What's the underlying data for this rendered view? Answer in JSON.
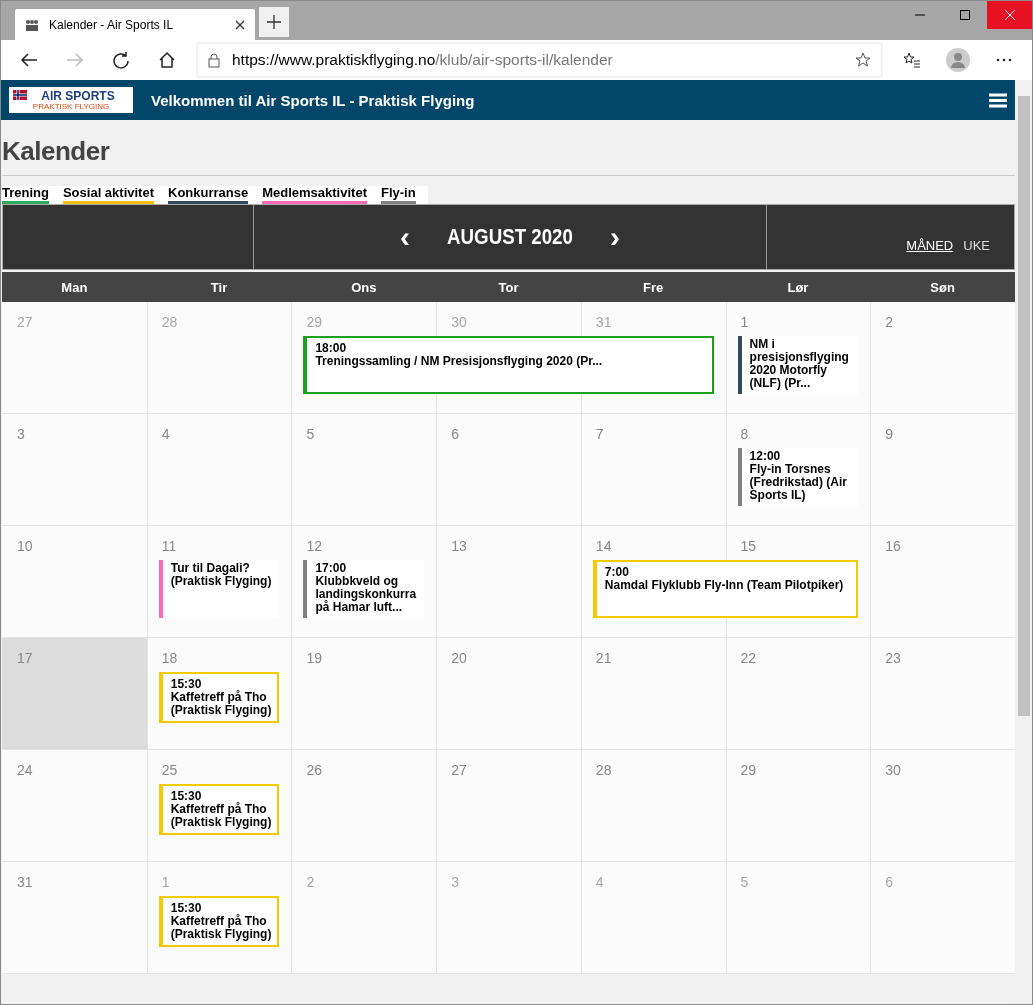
{
  "browser": {
    "tab_title": "Kalender - Air Sports IL",
    "url_host": "https://www.praktiskflyging.no",
    "url_path": "/klub/air-sports-il/kalender"
  },
  "site": {
    "logo_title": "AIR SPORTS",
    "logo_subtitle": "PRAKTISK FLYGING",
    "title": "Velkommen til Air Sports IL - Praktisk Flyging"
  },
  "page_title": "Kalender",
  "legend": [
    {
      "label": "Trening",
      "color": "#2eaa5c"
    },
    {
      "label": "Sosial aktivitet",
      "color": "#f2c10f"
    },
    {
      "label": "Konkurranse",
      "color": "#34495e"
    },
    {
      "label": "Medlemsaktivitet",
      "color": "#ff69b4"
    },
    {
      "label": "Fly-in",
      "color": "#808080"
    }
  ],
  "nav": {
    "prev": "‹",
    "month": "AUGUST 2020",
    "next": "›",
    "views": [
      {
        "label": "MÅNED",
        "selected": true
      },
      {
        "label": "UKE",
        "selected": false
      }
    ]
  },
  "weekdays": [
    "Man",
    "Tir",
    "Ons",
    "Tor",
    "Fre",
    "Lør",
    "Søn"
  ],
  "weeks": [
    {
      "days": [
        {
          "label": "27",
          "other_month": true,
          "today": false
        },
        {
          "label": "28",
          "other_month": true,
          "today": false
        },
        {
          "label": "29",
          "other_month": true,
          "today": false,
          "events": [
            {
              "kind": "boxed",
              "color": "#1aa31a",
              "time": "18:00",
              "title": "Treningssamling / NM Presisjonsflyging 2020 (Pr..."
            }
          ]
        },
        {
          "label": "30",
          "other_month": true,
          "today": false
        },
        {
          "label": "31",
          "other_month": true,
          "today": false
        },
        {
          "label": "1",
          "other_month": false,
          "today": false,
          "events": [
            {
              "kind": "bar",
              "color": "#34495e",
              "title": "NM i presisjonsflyging 2020 Motorfly (NLF) (Pr..."
            }
          ]
        },
        {
          "label": "2",
          "other_month": false,
          "today": false
        }
      ]
    },
    {
      "days": [
        {
          "label": "3",
          "other_month": false,
          "today": false
        },
        {
          "label": "4",
          "other_month": false,
          "today": false
        },
        {
          "label": "5",
          "other_month": false,
          "today": false
        },
        {
          "label": "6",
          "other_month": false,
          "today": false
        },
        {
          "label": "7",
          "other_month": false,
          "today": false
        },
        {
          "label": "8",
          "other_month": false,
          "today": false,
          "events": [
            {
              "kind": "bar",
              "color": "#808080",
              "time": "12:00",
              "title": "Fly-in Torsnes (Fredrikstad) (Air Sports IL)"
            }
          ]
        },
        {
          "label": "9",
          "other_month": false,
          "today": false
        }
      ]
    },
    {
      "days": [
        {
          "label": "10",
          "other_month": false,
          "today": false
        },
        {
          "label": "11",
          "other_month": false,
          "today": false,
          "events": [
            {
              "kind": "bar",
              "color": "#ff69b4",
              "title": "Tur til Dagali? (Praktisk Flyging)"
            }
          ]
        },
        {
          "label": "12",
          "other_month": false,
          "today": false,
          "events": [
            {
              "kind": "bar",
              "color": "#808080",
              "time": "17:00",
              "title": "Klubbkveld og landingskonkurra på Hamar luft..."
            }
          ]
        },
        {
          "label": "13",
          "other_month": false,
          "today": false
        },
        {
          "label": "14",
          "other_month": false,
          "today": false,
          "events": [
            {
              "kind": "boxed",
              "color": "#f2cc00",
              "time": "7:00",
              "title": "Namdal Flyklubb Fly-Inn (Team Pilotpiker)"
            }
          ]
        },
        {
          "label": "15",
          "other_month": false,
          "today": false
        },
        {
          "label": "16",
          "other_month": false,
          "today": false
        }
      ]
    },
    {
      "days": [
        {
          "label": "17",
          "other_month": false,
          "today": true
        },
        {
          "label": "18",
          "other_month": false,
          "today": false,
          "events": [
            {
              "kind": "boxed",
              "color": "#f2cc00",
              "time": "15:30",
              "title": "Kaffetreff på Tho (Praktisk Flyging)"
            }
          ]
        },
        {
          "label": "19",
          "other_month": false,
          "today": false
        },
        {
          "label": "20",
          "other_month": false,
          "today": false
        },
        {
          "label": "21",
          "other_month": false,
          "today": false
        },
        {
          "label": "22",
          "other_month": false,
          "today": false
        },
        {
          "label": "23",
          "other_month": false,
          "today": false
        }
      ]
    },
    {
      "days": [
        {
          "label": "24",
          "other_month": false,
          "today": false
        },
        {
          "label": "25",
          "other_month": false,
          "today": false,
          "events": [
            {
              "kind": "boxed",
              "color": "#f2cc00",
              "time": "15:30",
              "title": "Kaffetreff på Tho (Praktisk Flyging)"
            }
          ]
        },
        {
          "label": "26",
          "other_month": false,
          "today": false
        },
        {
          "label": "27",
          "other_month": false,
          "today": false
        },
        {
          "label": "28",
          "other_month": false,
          "today": false
        },
        {
          "label": "29",
          "other_month": false,
          "today": false
        },
        {
          "label": "30",
          "other_month": false,
          "today": false
        }
      ]
    },
    {
      "days": [
        {
          "label": "31",
          "other_month": false,
          "today": false
        },
        {
          "label": "1",
          "other_month": true,
          "today": false,
          "events": [
            {
              "kind": "boxed",
              "color": "#f2cc00",
              "time": "15:30",
              "title": "Kaffetreff på Tho (Praktisk Flyging)"
            }
          ]
        },
        {
          "label": "2",
          "other_month": true,
          "today": false
        },
        {
          "label": "3",
          "other_month": true,
          "today": false
        },
        {
          "label": "4",
          "other_month": true,
          "today": false
        },
        {
          "label": "5",
          "other_month": true,
          "today": false
        },
        {
          "label": "6",
          "other_month": true,
          "today": false
        }
      ]
    }
  ]
}
